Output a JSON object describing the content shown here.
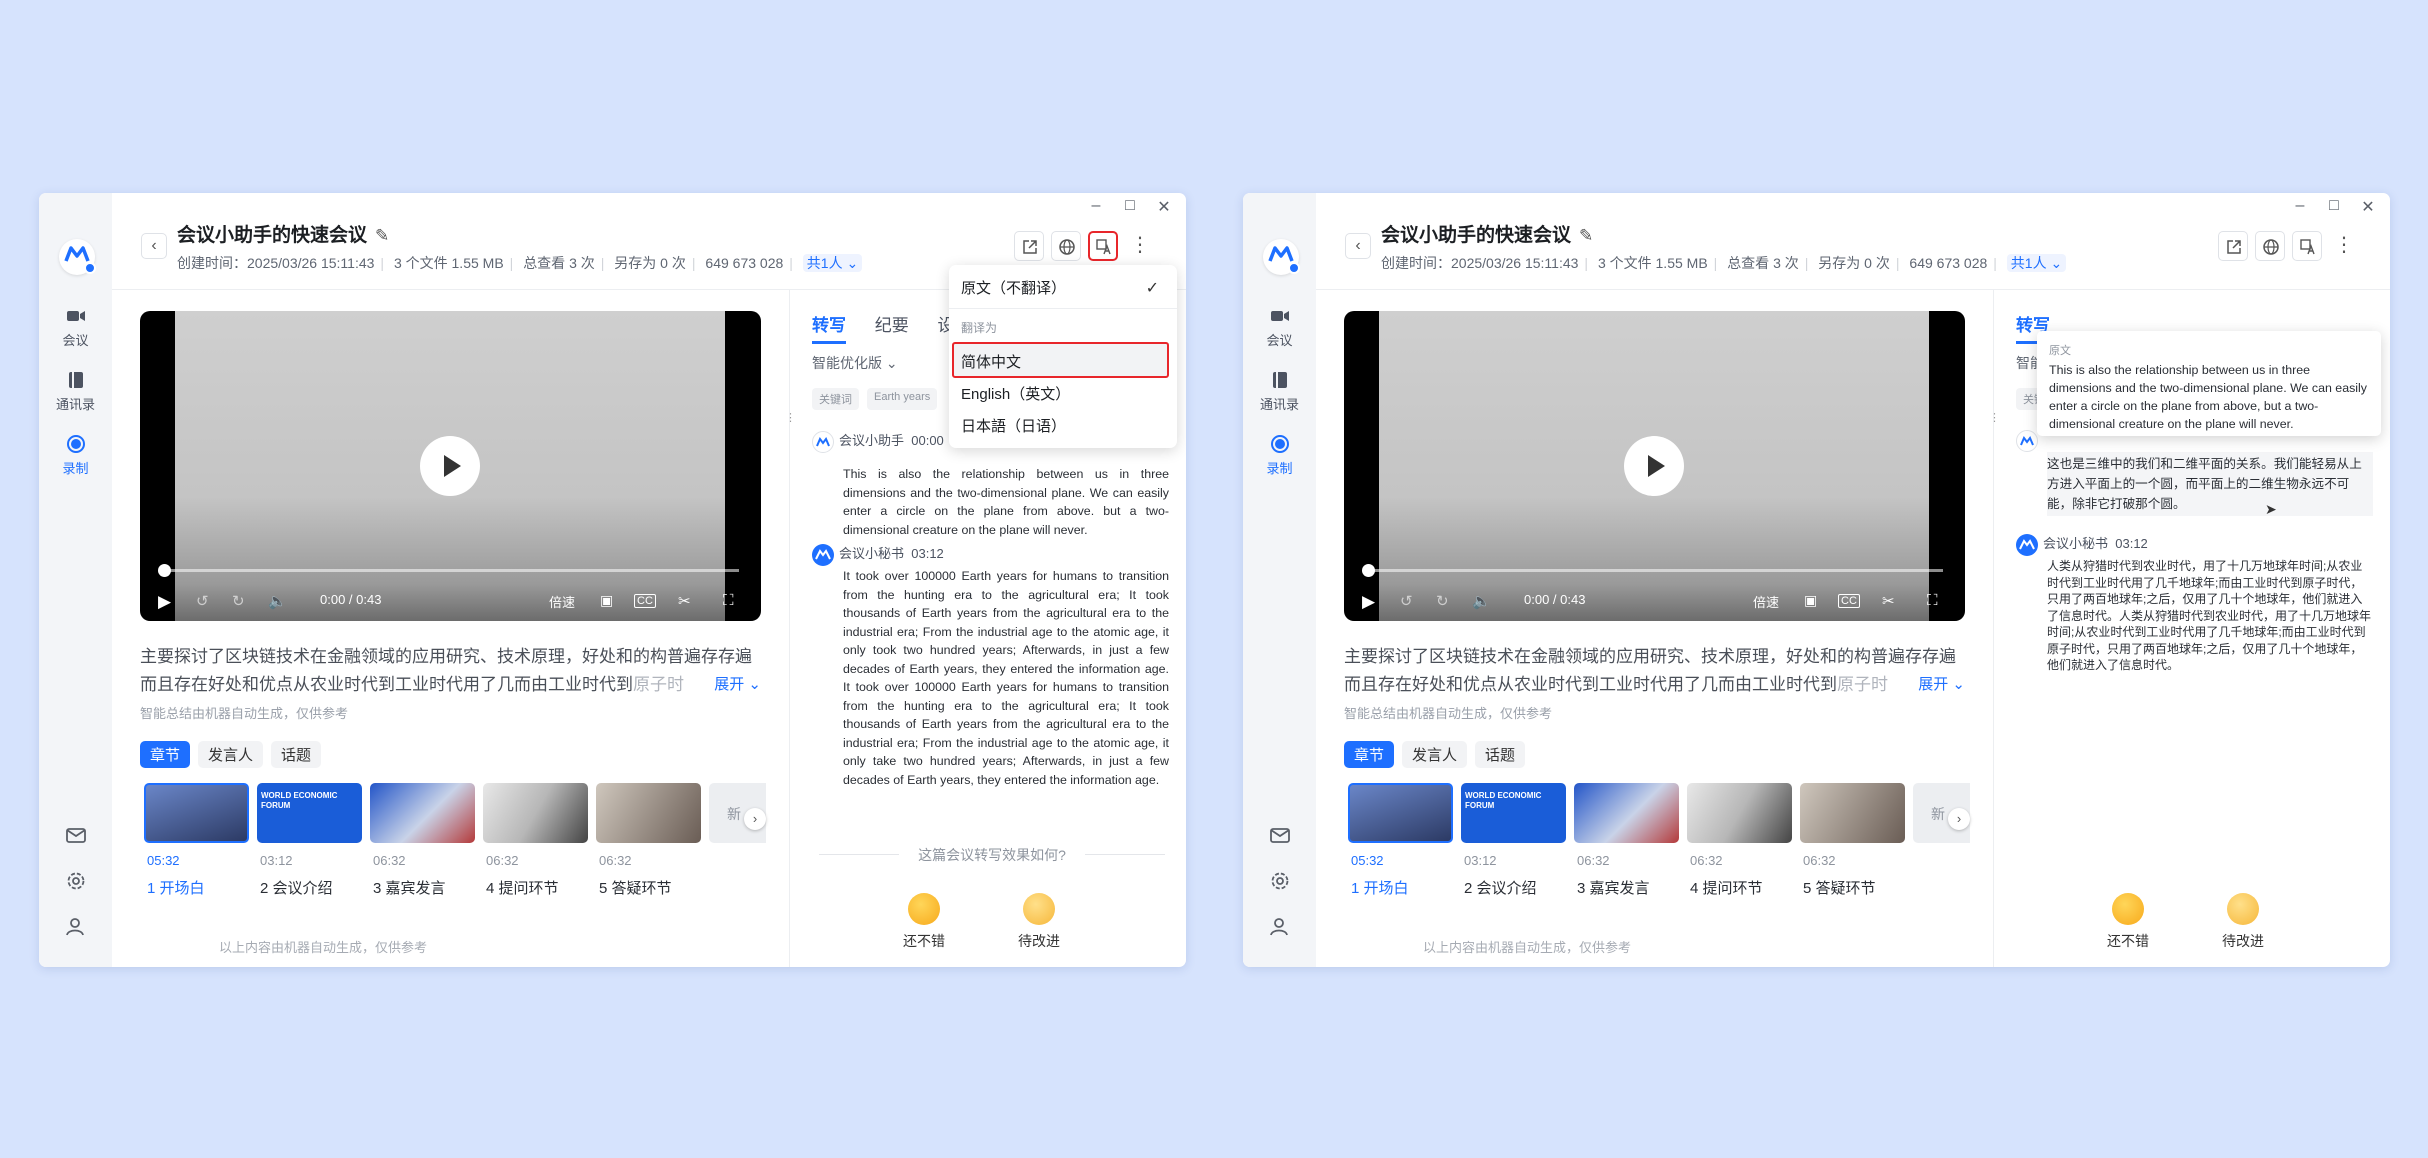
{
  "left": {
    "title": "会议小助手的快速会议",
    "meta": {
      "created": "创建时间：2025/03/26 15:11:43",
      "files": "3 个文件 1.55 MB",
      "views": "总查看 3 次",
      "saves": "另存为 0 次",
      "id": "649 673 028",
      "share": "共1人"
    },
    "nav": {
      "meeting": "会议",
      "contacts": "通讯录",
      "record": "录制"
    },
    "player": {
      "time": "0:00 / 0:43",
      "speed": "倍速",
      "cc": "CC"
    },
    "summary": {
      "text": "主要探讨了区块链技术在金融领域的应用研究、技术原理，好处和的构普遍存存遍而且存在好处和优点从农业时代到工业时代用了几而由工业时代到",
      "fade": "原子时",
      "expand": "展开",
      "auto": "智能总结由机器自动生成，仅供参考"
    },
    "pills": [
      "章节",
      "发言人",
      "话题"
    ],
    "thumb_texts": {
      "wef": "WORLD ECONOMIC FORUM",
      "new": "新"
    },
    "chapters": [
      {
        "time": "05:32",
        "name": "1 开场白"
      },
      {
        "time": "03:12",
        "name": "2 会议介绍"
      },
      {
        "time": "06:32",
        "name": "3 嘉宾发言"
      },
      {
        "time": "06:32",
        "name": "4 提问环节"
      },
      {
        "time": "06:32",
        "name": "5 答疑环节"
      }
    ],
    "footer": "以上内容由机器自动生成，仅供参考",
    "tabs": [
      "转写",
      "纪要",
      "设"
    ],
    "opt": "智能优化版",
    "keywords": [
      "关键词",
      "Earth years"
    ],
    "speaker1": {
      "name": "会议小助手",
      "time": "00:00"
    },
    "para1": "This is also the relationship between us in three dimensions and the two-dimensional plane. We can easily enter a circle on the plane from above. but a two-dimensional creature on the plane will never.",
    "speaker2": {
      "name": "会议小秘书",
      "time": "03:12"
    },
    "para2": "It took over 100000 Earth years for humans to transition from the hunting era to the agricultural era; It took thousands of Earth years from the agricultural era to the industrial era; From the industrial age to the atomic age, it only took two hundred years; Afterwards, in just a few decades of Earth years, they entered the information age. It took over 100000 Earth years for humans to transition from the hunting era to the agricultural era; It took thousands of Earth years from the agricultural era to the industrial era; From the industrial age to the atomic age, it only take two hundred years; Afterwards, in just a few decades of Earth years, they entered the information age.",
    "question": "这篇会议转写效果如何?",
    "emotions": [
      "还不错",
      "待改进"
    ],
    "dropdown": {
      "original": "原文（不翻译）",
      "group": "翻译为",
      "zh": "简体中文",
      "en": "English（英文）",
      "ja": "日本語（日语）"
    }
  },
  "right": {
    "title": "会议小助手的快速会议",
    "meta": {
      "created": "创建时间：2025/03/26 15:11:43",
      "files": "3 个文件 1.55 MB",
      "views": "总查看 3 次",
      "saves": "另存为 0 次",
      "id": "649 673 028",
      "share": "共1人"
    },
    "nav": {
      "meeting": "会议",
      "contacts": "通讯录",
      "record": "录制"
    },
    "player": {
      "time": "0:00 / 0:43",
      "speed": "倍速",
      "cc": "CC"
    },
    "summary": {
      "text": "主要探讨了区块链技术在金融领域的应用研究、技术原理，好处和的构普遍存存遍而且存在好处和优点从农业时代到工业时代用了几而由工业时代到",
      "fade": "原子时",
      "expand": "展开",
      "auto": "智能总结由机器自动生成，仅供参考"
    },
    "pills": [
      "章节",
      "发言人",
      "话题"
    ],
    "thumb_texts": {
      "wef": "WORLD ECONOMIC FORUM",
      "new": "新"
    },
    "chapters": [
      {
        "time": "05:32",
        "name": "1 开场白"
      },
      {
        "time": "03:12",
        "name": "2 会议介绍"
      },
      {
        "time": "06:32",
        "name": "3 嘉宾发言"
      },
      {
        "time": "06:32",
        "name": "4 提问环节"
      },
      {
        "time": "06:32",
        "name": "5 答疑环节"
      }
    ],
    "footer": "以上内容由机器自动生成，仅供参考",
    "tabs": [
      "转写"
    ],
    "opt": "智能",
    "keywords": [
      "关键"
    ],
    "tooltip_head": "原文",
    "tooltip_body": "This is also the relationship between us in three dimensions and the two-dimensional plane. We can easily enter a circle on the plane from above, but a two-dimensional creature on the plane will never.",
    "zh1": "这也是三维中的我们和二维平面的关系。我们能轻易从上方进入平面上的一个圆，而平面上的二维生物永远不可能，除非它打破那个圆。",
    "speaker2": {
      "name": "会议小秘书",
      "time": "03:12"
    },
    "zh2": "人类从狩猎时代到农业时代，用了十几万地球年时间;从农业时代到工业时代用了几千地球年;而由工业时代到原子时代，只用了两百地球年;之后，仅用了几十个地球年，他们就进入了信息时代。人类从狩猎时代到农业时代，用了十几万地球年时间;从农业时代到工业时代用了几千地球年;而由工业时代到原子时代，只用了两百地球年;之后，仅用了几十个地球年，他们就进入了信息时代。",
    "emotions": [
      "还不错",
      "待改进"
    ]
  },
  "colors": {
    "accent": "#1e6fff",
    "highlight": "#e8262b",
    "background": "#d6e3fd"
  }
}
